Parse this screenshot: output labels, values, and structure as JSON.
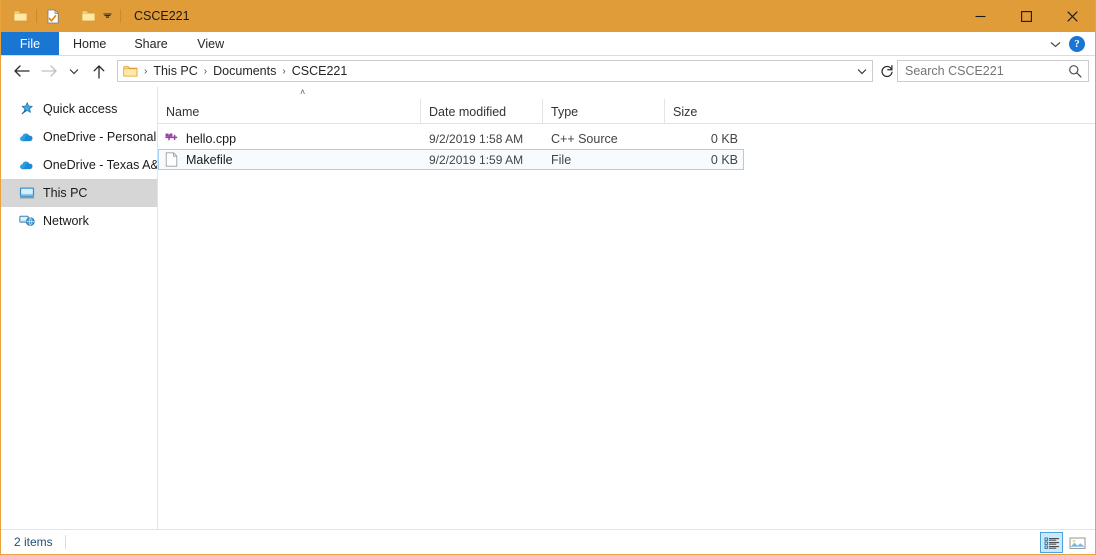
{
  "window": {
    "title": "CSCE221",
    "titlebar_color": "#e09c38",
    "border_color": "#e8a33d",
    "controls": [
      {
        "name": "minimize",
        "glyph": "minimize-icon"
      },
      {
        "name": "maximize",
        "glyph": "maximize-icon"
      },
      {
        "name": "close",
        "glyph": "close-icon"
      }
    ],
    "quick_access": [
      {
        "name": "folder-icon",
        "label": "Folder"
      },
      {
        "name": "properties-icon",
        "label": "Properties"
      },
      {
        "name": "new-folder-icon",
        "label": "New folder"
      },
      {
        "name": "chevron-down-icon",
        "label": "Customize Quick Access Toolbar"
      }
    ]
  },
  "ribbon": {
    "tabs": [
      {
        "label": "File",
        "active": true
      },
      {
        "label": "Home",
        "active": false
      },
      {
        "label": "Share",
        "active": false
      },
      {
        "label": "View",
        "active": false
      }
    ],
    "expand_label": "chevron-down-icon",
    "help_label": "?",
    "accent_color": "#1976d2"
  },
  "address": {
    "back_label": "Back",
    "forward_label": "Forward",
    "recent_label": "Recent locations",
    "up_label": "Up",
    "breadcrumbs": [
      {
        "label": "This PC"
      },
      {
        "label": "Documents"
      },
      {
        "label": "CSCE221"
      }
    ],
    "separator": "›",
    "refresh_label": "Refresh"
  },
  "search": {
    "placeholder": "Search CSCE221",
    "value": ""
  },
  "sidebar": {
    "items": [
      {
        "label": "Quick access",
        "icon": "star-icon",
        "selected": false
      },
      {
        "label": "OneDrive - Personal",
        "icon": "cloud-icon",
        "selected": false
      },
      {
        "label": "OneDrive - Texas A&I",
        "icon": "cloud-icon",
        "selected": false
      },
      {
        "label": "This PC",
        "icon": "monitor-icon",
        "selected": true
      },
      {
        "label": "Network",
        "icon": "network-icon",
        "selected": false
      }
    ]
  },
  "filelist": {
    "sort_indicator": "˄",
    "columns": [
      {
        "label": "Name"
      },
      {
        "label": "Date modified"
      },
      {
        "label": "Type"
      },
      {
        "label": "Size"
      }
    ],
    "rows": [
      {
        "name": "hello.cpp",
        "date_modified": "9/2/2019 1:58 AM",
        "type": "C++ Source",
        "size": "0 KB",
        "icon": "cpp-source-icon",
        "selected": false
      },
      {
        "name": "Makefile",
        "date_modified": "9/2/2019 1:59 AM",
        "type": "File",
        "size": "0 KB",
        "icon": "blank-document-icon",
        "selected": true
      }
    ]
  },
  "statusbar": {
    "item_count": "2 items",
    "views": [
      {
        "name": "details-view",
        "active": true
      },
      {
        "name": "large-icons-view",
        "active": false
      }
    ]
  }
}
